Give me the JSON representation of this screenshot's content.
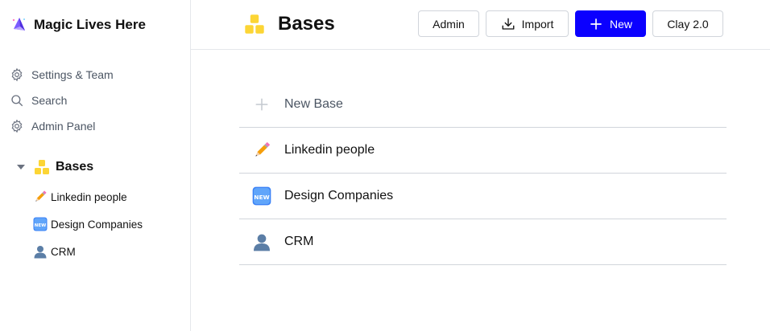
{
  "workspace": {
    "name": "Magic Lives Here",
    "icon": "magic-prism-icon"
  },
  "nav": {
    "items": [
      {
        "label": "Settings & Team",
        "icon": "gear-icon"
      },
      {
        "label": "Search",
        "icon": "search-icon"
      },
      {
        "label": "Admin Panel",
        "icon": "gear-icon"
      }
    ]
  },
  "tree": {
    "root": {
      "label": "Bases",
      "icon": "blocks-icon",
      "expanded": true
    },
    "children": [
      {
        "label": "Linkedin people",
        "icon": "pencil-emoji"
      },
      {
        "label": "Design Companies",
        "icon": "new-emoji"
      },
      {
        "label": "CRM",
        "icon": "bust-silhouette-emoji"
      }
    ]
  },
  "header": {
    "title": "Bases",
    "title_icon": "blocks-icon",
    "buttons": {
      "admin": "Admin",
      "import": "Import",
      "new": "New",
      "version": "Clay 2.0"
    }
  },
  "list": {
    "new_base": "New Base",
    "rows": [
      {
        "label": "Linkedin people",
        "icon": "pencil-emoji"
      },
      {
        "label": "Design Companies",
        "icon": "new-emoji"
      },
      {
        "label": "CRM",
        "icon": "bust-silhouette-emoji"
      }
    ]
  },
  "colors": {
    "accent": "#0b00ff",
    "blocks_yellow": "#fcd535",
    "border": "#d1d5db",
    "muted_text": "#4b5563"
  }
}
